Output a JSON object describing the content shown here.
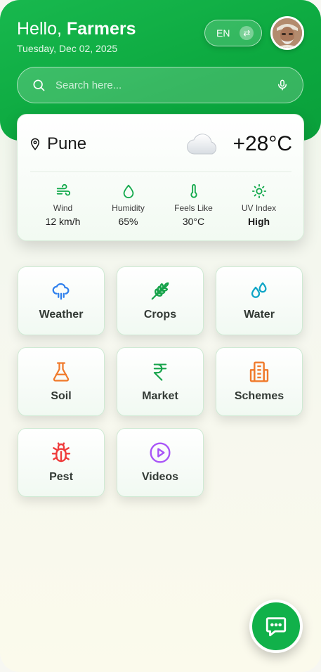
{
  "header": {
    "greeting_prefix": "Hello,",
    "greeting_name": "Farmers",
    "date": "Tuesday, Dec 02, 2025",
    "language": "EN",
    "language_swap_glyph": "⇄",
    "brand_color": "#11b14a"
  },
  "search": {
    "placeholder": "Search here...",
    "icon": "search-icon",
    "voice_icon": "microphone-icon"
  },
  "weather": {
    "city": "Pune",
    "temperature": "+28°C",
    "condition_icon": "cloud-icon",
    "stats": [
      {
        "icon": "wind-icon",
        "label": "Wind",
        "value": "12 km/h"
      },
      {
        "icon": "droplet-icon",
        "label": "Humidity",
        "value": "65%"
      },
      {
        "icon": "thermometer-icon",
        "label": "Feels Like",
        "value": "30°C"
      },
      {
        "icon": "sun-icon",
        "label": "UV Index",
        "value": "High"
      }
    ]
  },
  "tiles": [
    {
      "label": "Weather",
      "icon": "cloud-rain-icon",
      "color": "#2f80ed"
    },
    {
      "label": "Crops",
      "icon": "wheat-icon",
      "color": "#16a34a"
    },
    {
      "label": "Water",
      "icon": "droplets-icon",
      "color": "#0ea5c6"
    },
    {
      "label": "Soil",
      "icon": "flask-icon",
      "color": "#f07a2b"
    },
    {
      "label": "Market",
      "icon": "rupee-icon",
      "color": "#16a34a"
    },
    {
      "label": "Schemes",
      "icon": "building-icon",
      "color": "#f07a2b"
    },
    {
      "label": "Pest",
      "icon": "bug-icon",
      "color": "#ef3b3b"
    },
    {
      "label": "Videos",
      "icon": "play-circle-icon",
      "color": "#a855f7"
    }
  ],
  "fab": {
    "icon": "chat-icon"
  }
}
